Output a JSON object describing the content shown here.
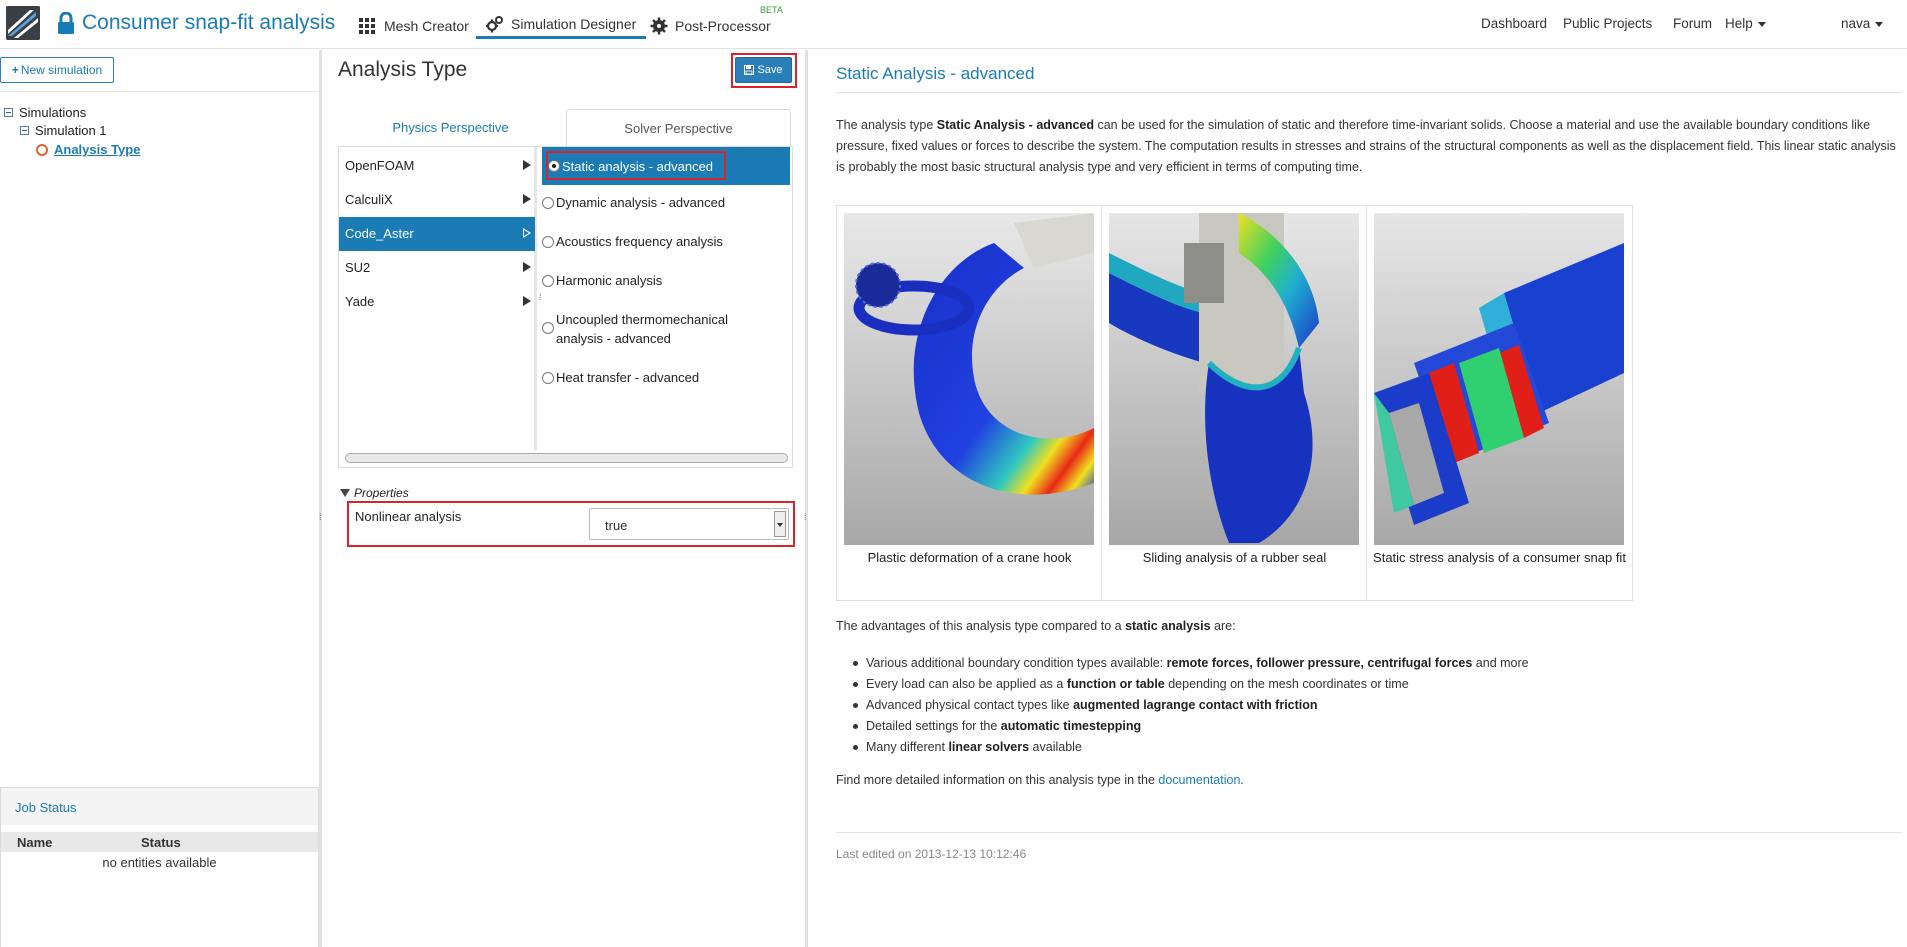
{
  "header": {
    "app_title": "Consumer snap-fit analysis",
    "tabs": [
      {
        "label": "Mesh Creator",
        "icon": "grid-icon"
      },
      {
        "label": "Simulation Designer",
        "icon": "gears-icon",
        "active": true
      },
      {
        "label": "Post-Processor",
        "icon": "cog-icon",
        "badge": "BETA"
      }
    ],
    "links": [
      "Dashboard",
      "Public Projects",
      "Forum",
      "Help"
    ],
    "user": "nava"
  },
  "sidebar": {
    "new_button": "New simulation",
    "tree": {
      "root": "Simulations",
      "child": "Simulation 1",
      "leaf": "Analysis Type"
    },
    "job_status": {
      "title": "Job Status",
      "columns": [
        "Name",
        "Status"
      ],
      "empty": "no entities available"
    }
  },
  "middle": {
    "title": "Analysis Type",
    "save_label": "Save",
    "perspectives": [
      "Physics Perspective",
      "Solver Perspective"
    ],
    "solvers": [
      "OpenFOAM",
      "CalculiX",
      "Code_Aster",
      "SU2",
      "Yade"
    ],
    "selected_solver": "Code_Aster",
    "analysis_types": [
      "Static analysis - advanced",
      "Dynamic analysis - advanced",
      "Acoustics frequency analysis",
      "Harmonic analysis",
      "Uncoupled thermomechanical analysis - advanced",
      "Heat transfer - advanced"
    ],
    "selected_analysis": "Static analysis - advanced",
    "properties": {
      "heading": "Properties",
      "label": "Nonlinear analysis",
      "value": "true"
    }
  },
  "detail": {
    "title": "Static Analysis - advanced",
    "intro_prefix": "The analysis type ",
    "intro_bold": "Static Analysis - advanced",
    "intro_rest": " can be used for the simulation of static and therefore time-invariant solids. Choose a material and use the available boundary conditions like pressure, fixed values or forces to describe the system. The computation results in stresses and strains of the structural components as well as the displacement field. This linear static analysis is probably the most basic structural analysis type and very efficient in terms of computing time.",
    "captions": [
      "Plastic deformation of a crane hook",
      "Sliding analysis of a rubber seal",
      "Static stress analysis of a consumer snap fit"
    ],
    "adv_prefix": "The advantages of this analysis type compared to a ",
    "adv_bold": "static analysis",
    "adv_suffix": " are:",
    "bullets": [
      {
        "pre": "Various additional boundary condition types available: ",
        "bold": "remote forces, follower pressure, centrifugal forces",
        "post": " and more"
      },
      {
        "pre": "Every load can also be applied as a ",
        "bold": "function or table",
        "post": " depending on the mesh coordinates or time"
      },
      {
        "pre": "Advanced physical contact types like ",
        "bold": "augmented lagrange contact with friction",
        "post": ""
      },
      {
        "pre": "Detailed settings for the ",
        "bold": "automatic timestepping",
        "post": ""
      },
      {
        "pre": "Many different ",
        "bold": "linear solvers",
        "post": " available"
      }
    ],
    "more_prefix": "Find more detailed information on this analysis type in the ",
    "more_link": "documentation",
    "more_suffix": ".",
    "last_edited": "Last edited on 2013-12-13 10:12:46"
  }
}
